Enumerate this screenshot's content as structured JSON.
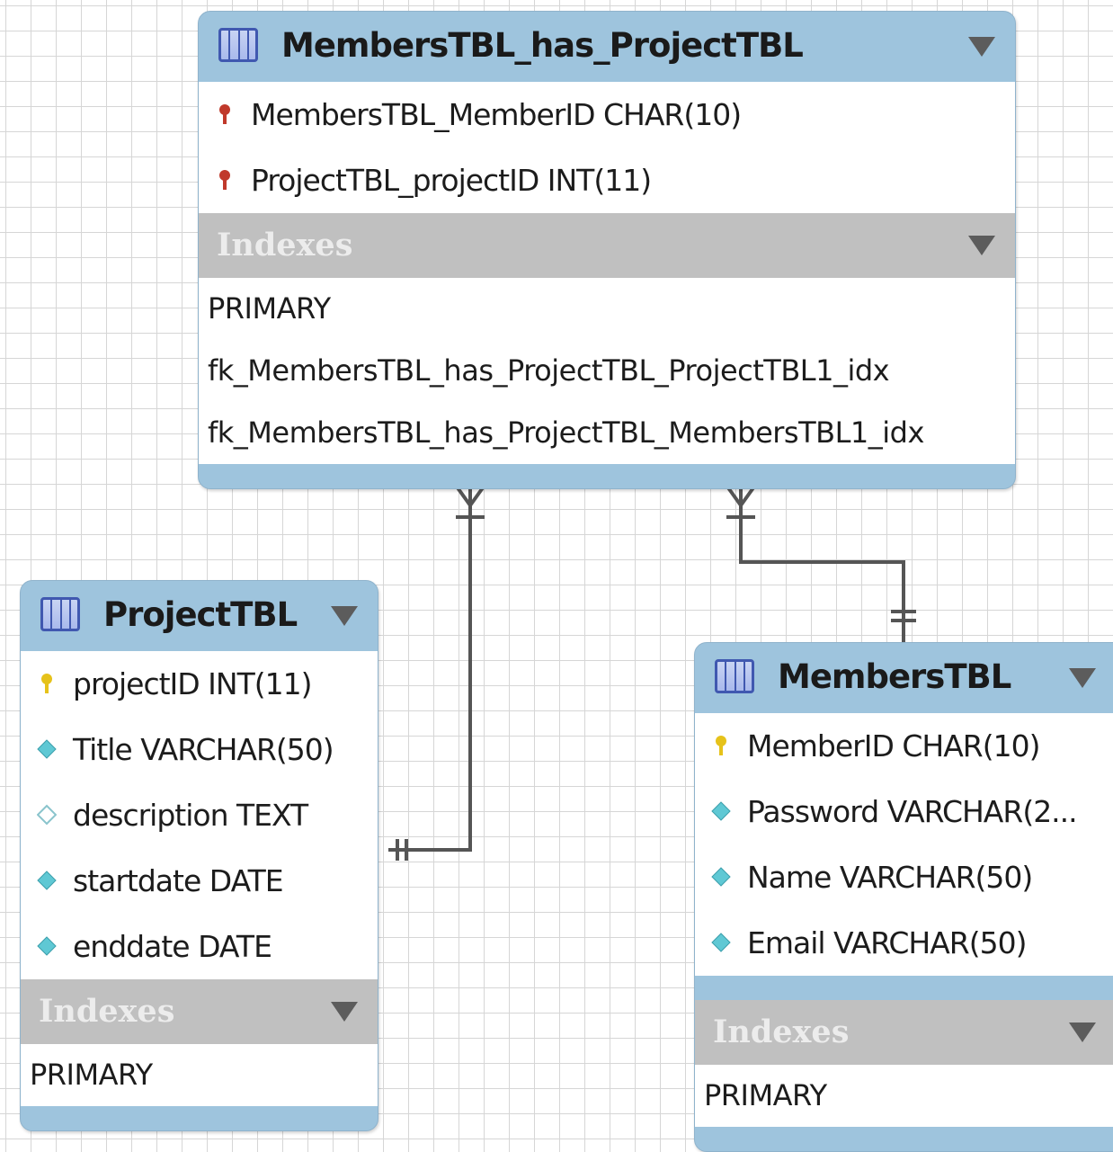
{
  "tables": {
    "members_has_project": {
      "title": "MembersTBL_has_ProjectTBL",
      "columns": [
        {
          "text": "MembersTBL_MemberID CHAR(10)",
          "icon": "foreign-key-icon"
        },
        {
          "text": "ProjectTBL_projectID INT(11)",
          "icon": "foreign-key-icon"
        }
      ],
      "indexes_label": "Indexes",
      "indexes": [
        "PRIMARY",
        "fk_MembersTBL_has_ProjectTBL_ProjectTBL1_idx",
        "fk_MembersTBL_has_ProjectTBL_MembersTBL1_idx"
      ]
    },
    "project": {
      "title": "ProjectTBL",
      "columns": [
        {
          "text": "projectID INT(11)",
          "icon": "primary-key-icon"
        },
        {
          "text": "Title VARCHAR(50)",
          "icon": "not-null-column-icon"
        },
        {
          "text": "description TEXT",
          "icon": "nullable-column-icon"
        },
        {
          "text": "startdate DATE",
          "icon": "not-null-column-icon"
        },
        {
          "text": "enddate DATE",
          "icon": "not-null-column-icon"
        }
      ],
      "indexes_label": "Indexes",
      "indexes": [
        "PRIMARY"
      ]
    },
    "members": {
      "title": "MembersTBL",
      "columns": [
        {
          "text": "MemberID CHAR(10)",
          "icon": "primary-key-icon"
        },
        {
          "text": "Password VARCHAR(2...",
          "icon": "not-null-column-icon"
        },
        {
          "text": "Name VARCHAR(50)",
          "icon": "not-null-column-icon"
        },
        {
          "text": "Email VARCHAR(50)",
          "icon": "not-null-column-icon"
        }
      ],
      "indexes_label": "Indexes",
      "indexes": [
        "PRIMARY"
      ]
    }
  },
  "relationships": [
    {
      "from": "ProjectTBL",
      "to": "MembersTBL_has_ProjectTBL",
      "from_cardinality": "one-and-only-one",
      "to_cardinality": "one-or-many"
    },
    {
      "from": "MembersTBL",
      "to": "MembersTBL_has_ProjectTBL",
      "from_cardinality": "one-and-only-one",
      "to_cardinality": "one-or-many"
    }
  ],
  "colors": {
    "header": "#9ec4dd",
    "indexes_bar": "#c0c0c0",
    "connector": "#555555",
    "foreign_key": "#c0392b",
    "primary_key": "#e6c21a",
    "column_diamond": "#5fc8d4"
  }
}
